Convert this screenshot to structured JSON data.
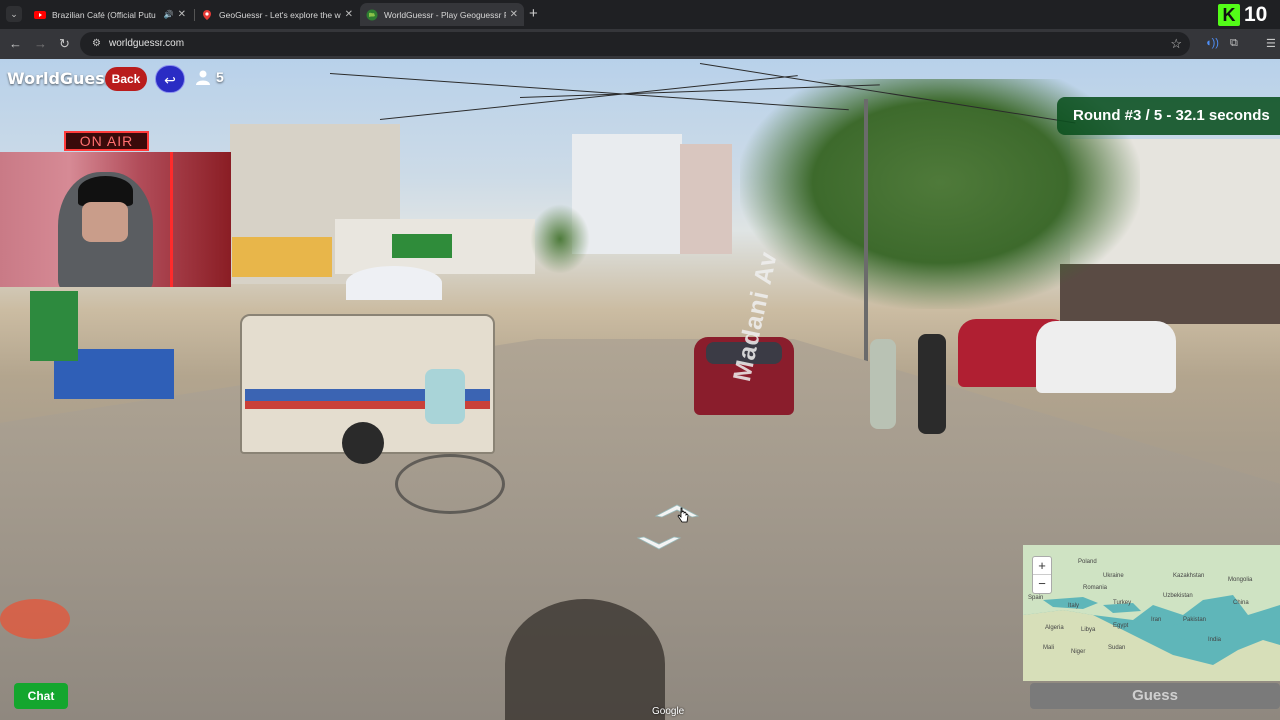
{
  "browser": {
    "tabs": [
      {
        "title": "Brazilian Café (Official Putu",
        "favicon": "youtube-icon",
        "audio": true,
        "active": false
      },
      {
        "title": "GeoGuessr - Let's explore the w",
        "favicon": "map-pin-icon",
        "audio": false,
        "active": false
      },
      {
        "title": "WorldGuessr - Play Geoguessr F",
        "favicon": "globe-icon",
        "audio": false,
        "active": true
      }
    ],
    "new_tab": "+",
    "url": "worldguessr.com",
    "kick_count": "10"
  },
  "game": {
    "brand": "WorldGuessr",
    "back_label": "Back",
    "players": "5",
    "round_text": "Round #3 / 5 - 32.1 seconds",
    "onair_label": "ON AIR",
    "chat_label": "Chat",
    "guess_label": "Guess",
    "road_label": "Madani Av",
    "google_label": "Google"
  },
  "minimap": {
    "zoom_in": "+",
    "zoom_out": "−",
    "labels": [
      "Poland",
      "Ukraine",
      "Kazakhstan",
      "Mongolia",
      "Romania",
      "Italy",
      "Spain",
      "Turkey",
      "Uzbekistan",
      "China",
      "Algeria",
      "Libya",
      "Egypt",
      "Iran",
      "Pakistan",
      "Mali",
      "Niger",
      "Sudan",
      "India"
    ]
  },
  "colors": {
    "back_button": "#b91c1c",
    "return_button": "#2a2cc4",
    "round_banner": "#0a501e",
    "chat_button": "#14a62e",
    "kick_brand": "#53fc18"
  }
}
